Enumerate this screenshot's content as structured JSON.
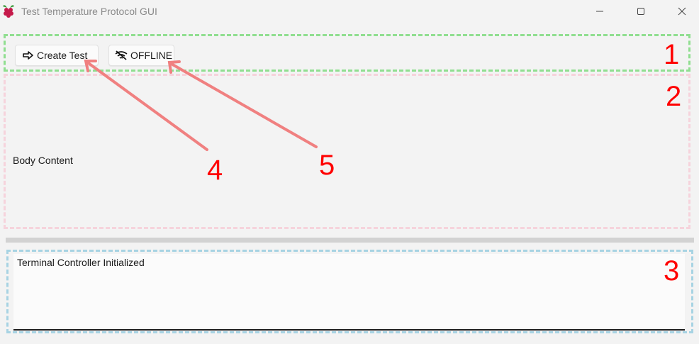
{
  "window": {
    "title": "Test Temperature Protocol GUI",
    "controls": [
      "minimize",
      "maximize",
      "close"
    ]
  },
  "toolbar": {
    "create_test_label": "Create Test",
    "create_test_icon": "arrow-right-icon",
    "offline_label": "OFFLINE",
    "offline_icon": "wifi-off-icon"
  },
  "body": {
    "content_label": "Body Content"
  },
  "terminal": {
    "output": "Terminal Controller Initialized"
  },
  "annotations": {
    "region_numbers": [
      "1",
      "2",
      "3"
    ],
    "arrow_numbers": [
      "4",
      "5"
    ],
    "colors": {
      "region_1": "#90de90",
      "region_2": "#f6d3dc",
      "region_3": "#a7d3e3",
      "arrow": "#f08080",
      "number": "#ff0000"
    }
  }
}
